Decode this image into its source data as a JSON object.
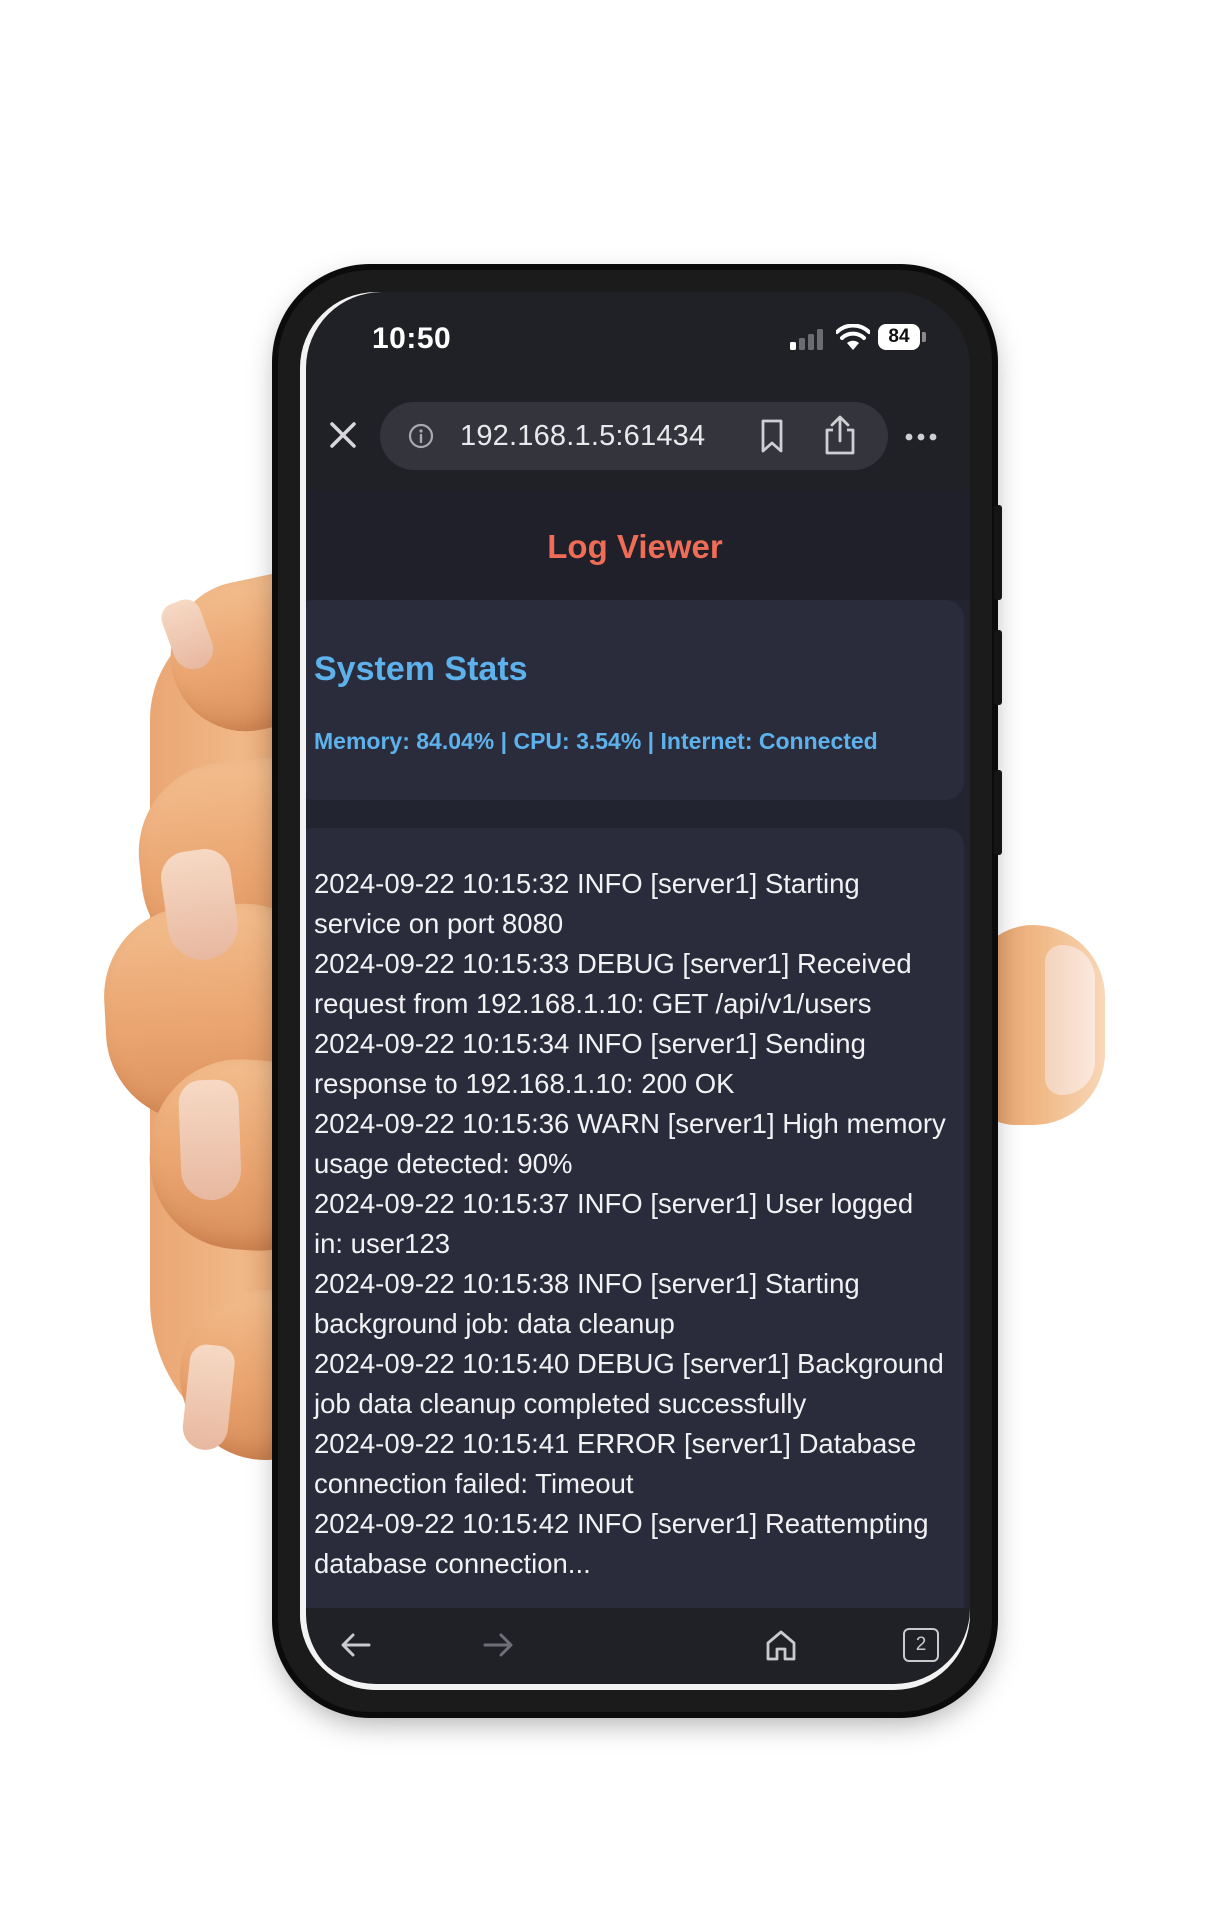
{
  "status_bar": {
    "time": "10:50",
    "battery": "84",
    "signal_bars_active": 1,
    "wifi": "connected"
  },
  "browser": {
    "url": "192.168.1.5:61434",
    "icons": {
      "close": "close-icon",
      "info": "info-icon",
      "bookmark": "bookmark-icon",
      "share": "share-icon",
      "more": "more-icon"
    }
  },
  "page": {
    "title": "Log Viewer",
    "stats": {
      "title": "System Stats",
      "line": "Memory: 84.04% | CPU: 3.54% | Internet: Connected"
    },
    "logs": [
      "2024-09-22 10:15:32 INFO [server1] Starting service on port 8080",
      "2024-09-22 10:15:33 DEBUG [server1] Received request from 192.168.1.10: GET /api/v1/users",
      "2024-09-22 10:15:34 INFO [server1] Sending response to 192.168.1.10: 200 OK",
      "2024-09-22 10:15:36 WARN [server1] High memory usage detected: 90%",
      "2024-09-22 10:15:37 INFO [server1] User logged in: user123",
      "2024-09-22 10:15:38 INFO [server1] Starting background job: data cleanup",
      "2024-09-22 10:15:40 DEBUG [server1] Background job data cleanup completed successfully",
      "2024-09-22 10:15:41 ERROR [server1] Database connection failed: Timeout",
      "2024-09-22 10:15:42 INFO [server1] Reattempting database connection..."
    ]
  },
  "bottom_bar": {
    "tabs_count": "2",
    "icons": {
      "back": "arrow-left-icon",
      "forward": "arrow-right-icon",
      "home": "home-icon",
      "tabs": "tabs-icon"
    }
  },
  "colors": {
    "title_accent": "#ef6c57",
    "stats_accent": "#5eb2ec",
    "page_background": "#22242f",
    "card_background": "#2a2c3c",
    "browser_chrome": "#202126"
  }
}
